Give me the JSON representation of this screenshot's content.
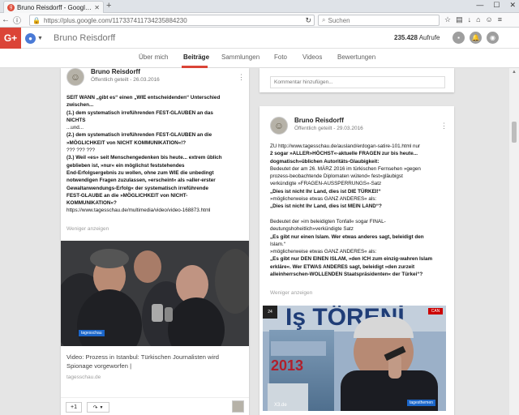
{
  "browser": {
    "tab_title": "Bruno Reisdorff - Google+",
    "url": "https://plus.google.com/117337411734235884230",
    "search_placeholder": "Suchen"
  },
  "header": {
    "app_logo": "G+",
    "profile_name": "Bruno Reisdorff",
    "views_count": "235.428",
    "views_label": "Aufrufe"
  },
  "profile_tabs": [
    "Über mich",
    "Beiträge",
    "Sammlungen",
    "Foto",
    "Videos",
    "Bewertungen"
  ],
  "left_post": {
    "author": "Bruno Reisdorff",
    "meta": "Öffentlich geteilt  -  26.03.2016",
    "lines": [
      {
        "text": " SEIT WANN „gibt es“ einen „WIE entscheidenden“ Unterschied",
        "bold": true
      },
      {
        "text": "zwischen...",
        "bold": true
      },
      {
        "text": "(1.) dem  systematisch irreführenden FEST-GLAUBEN an das",
        "bold": true
      },
      {
        "text": "NICHTS",
        "bold": true
      },
      {
        "text": "...und...",
        "bold": false
      },
      {
        "text": "(2.) dem  systematisch irreführenden FEST-GLAUBEN an die",
        "bold": true
      },
      {
        "text": "»MÖGLICHKEIT von NICHT KOMMUNIKATION«!?",
        "bold": true
      },
      {
        "text": "??? ??? ???",
        "bold": false
      },
      {
        "text": "(3.) Weil «es» seit Menschengedenken bis heute... extrem üblich",
        "bold": true
      },
      {
        "text": "geblieben ist, »nur« ein möglichst feststehendes",
        "bold": true
      },
      {
        "text": "End-Erfolgsergebnis zu wollen, ohne zum WIE die unbedingt",
        "bold": true
      },
      {
        "text": "notwendigen Fragen zuzulassen, »erscheint« als »aller-erster",
        "bold": true
      },
      {
        "text": "Gewaltanwendungs-Erfolg« der systematisch irreführende",
        "bold": true
      },
      {
        "text": "FEST-GLAUBE an die »MÖGLICHKEIT von NICHT-",
        "bold": true
      },
      {
        "text": "KOMMUNIKATION«?",
        "bold": true
      },
      {
        "text": "https://www.tagesschau.de/multimedia/video/video-168873.html",
        "bold": false
      }
    ],
    "less_label": "Weniger anzeigen",
    "image_badge": "tagesschau",
    "link_title": "Video: Prozess in Istanbul: Türkischen Journalisten wird Spionage vorgeworfen |",
    "link_source": "tagesschau.de",
    "plus_one": "+1",
    "share_icon": "↷"
  },
  "comment_box": {
    "placeholder": "Kommentar hinzufügen..."
  },
  "right_post": {
    "author": "Bruno Reisdorff",
    "meta": "Öffentlich geteilt  -  29.03.2016",
    "lines": [
      {
        "text": "ZU http://www.tagesschau.de/ausland/erdogan-satire-101.html nur",
        "bold": false
      },
      {
        "text": "2 sogar »ALLER»HÖCHST«-aktuelle FRAGEN zur bis heute...",
        "bold": true
      },
      {
        "text": "dogmatisch»üblichen Autoritäts-Glaubigkeit:",
        "bold": true
      },
      {
        "text": "Bedeutet der am 26. MÄRZ 2016 im türkischen Fernsehen »gegen",
        "bold": false
      },
      {
        "text": "prozess-beobachtende Diplomaten wütend« fest»gläubigst",
        "bold": false
      },
      {
        "text": "verkündigte »FRAGEN-AUSSPERRUNGS«-Satz",
        "bold": false
      },
      {
        "text": "„Dies ist nicht Ihr Land, dies ist DIE TÜRKEI!“",
        "bold": true
      },
      {
        "text": "»möglicherweise etwas GANZ ANDERES« als:",
        "bold": false
      },
      {
        "text": "„Dies ist nicht Ihr Land, dies ist MEIN LAND“?",
        "bold": true
      },
      {
        "text": "",
        "bold": false
      },
      {
        "text": "Bedeutet der »im beleidigten Tonfall« sogar FINAL-",
        "bold": false
      },
      {
        "text": "deutungshoheitlich»verkündigte Satz",
        "bold": false
      },
      {
        "text": "„Es gibt nur einen Islam. Wer etwas anderes sagt, beleidigt den",
        "bold": true
      },
      {
        "text": "Islam.“",
        "bold": false
      },
      {
        "text": "»möglicherweise etwas GANZ ANDERES« als:",
        "bold": false
      },
      {
        "text": "„Es gibt nur DEN EINEN ISLAM, »den ICH zum einzig-wahren Islam",
        "bold": true
      },
      {
        "text": "erkläre«. Wer ETWAS ANDERES sagt, beleidigt »den zurzeit",
        "bold": true
      },
      {
        "text": "alleinherrschen-WOLLENDEN Staatspräsidenten« der Türkei“?",
        "bold": true
      }
    ],
    "less_label": "Weniger anzeigen",
    "image_banner": "Iş TÖRENİ",
    "image_year": "2013",
    "image_badge": "tagesthemen",
    "image_watermark": "X3.de"
  },
  "colors": {
    "brand_red": "#db4437",
    "page_bg": "#e5e5e5"
  }
}
